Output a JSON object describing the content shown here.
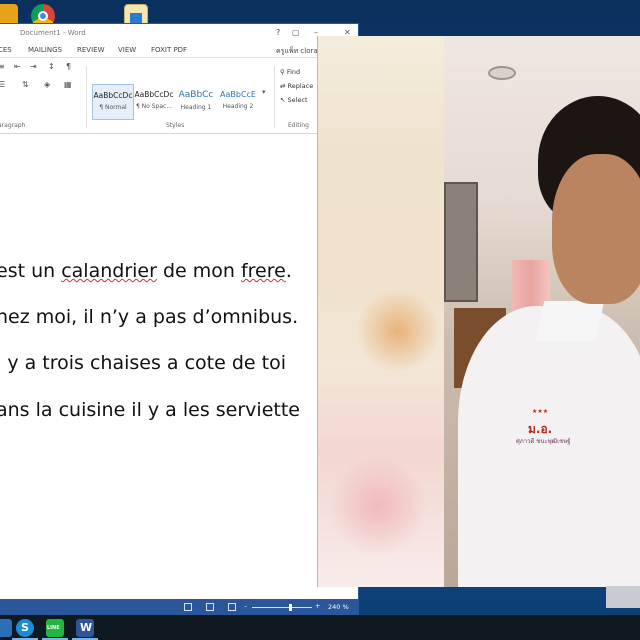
{
  "word": {
    "title": "Document1 - Word",
    "title_controls": {
      "help": "?",
      "restore": "▢",
      "minimize": "–",
      "close": "✕"
    },
    "tabs": [
      "CES",
      "MAILINGS",
      "REVIEW",
      "VIEW",
      "FOXIT PDF"
    ],
    "user_name": "ครูแพ็ท clorap",
    "ribbon": {
      "paragraph_label": "aragraph",
      "styles_label": "Styles",
      "editing_label": "Editing",
      "styles": [
        {
          "sample": "AaBbCcDc",
          "name": "¶ Normal"
        },
        {
          "sample": "AaBbCcDc",
          "name": "¶ No Spac..."
        },
        {
          "sample": "AaBbCc",
          "name": "Heading 1"
        },
        {
          "sample": "AaBbCcE",
          "name": "Heading 2"
        }
      ],
      "editing": {
        "find": "Find",
        "replace": "Replace",
        "select": "Select"
      }
    },
    "document": {
      "line1": {
        "before": "est un ",
        "word1": "calandrier",
        "middle": " de mon ",
        "word2": "frere",
        "after": "."
      },
      "line2": "hez moi, il n’y a pas d’omnibus.",
      "line3": "l y a trois chaises a cote de toi",
      "line4": "ans la cuisine il y a les serviette"
    },
    "status": {
      "zoom": "240 %",
      "zoom_fraction": 0.63
    }
  },
  "video": {
    "shirt_badge": "ม.อ.",
    "shirt_stars": "★★★",
    "shirt_name": "ศุภาวดี ชนะพุฒิเชษฐ์"
  },
  "taskbar": {
    "apps": [
      "skype",
      "line",
      "word"
    ]
  }
}
